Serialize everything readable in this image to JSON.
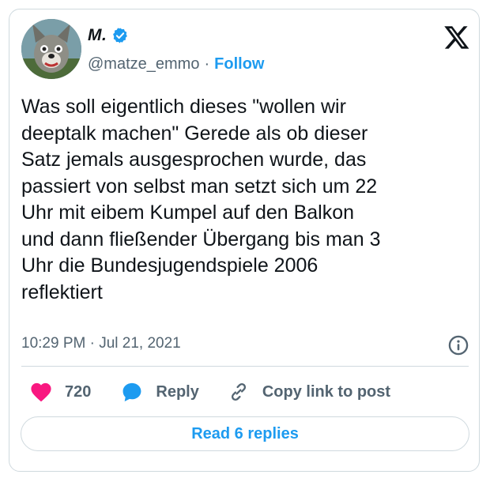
{
  "author": {
    "display_name": "M.",
    "handle": "@matze_emmo",
    "separator": "·",
    "follow_label": "Follow",
    "avatar_icon": "wolf-avatar",
    "verified_color": "#1d9bf0"
  },
  "tweet": {
    "text": "Was soll eigentlich dieses \"wollen wir\ndeeptalk machen\" Gerede als ob dieser\nSatz jemals ausgesprochen wurde, das\npassiert von selbst man setzt sich um 22\nUhr mit eibem Kumpel auf den Balkon\nund dann fließender Übergang bis man 3\nUhr die Bundesjugendspiele 2006\nreflektiert",
    "timestamp": "10:29 PM · Jul 21, 2021"
  },
  "actions": {
    "like_count": "720",
    "reply_label": "Reply",
    "copy_link_label": "Copy link to post"
  },
  "read_replies_label": "Read 6 replies",
  "colors": {
    "accent": "#1d9bf0",
    "like": "#f91880",
    "text": "#0f1419",
    "secondary": "#536471",
    "border": "#cfd9de"
  }
}
